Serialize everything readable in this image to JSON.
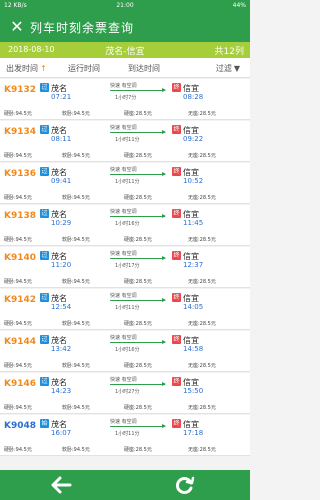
{
  "status": {
    "left": "12 KB/s",
    "center": "21:00",
    "right": "44%"
  },
  "header": {
    "title": "列车时刻余票查询"
  },
  "info": {
    "date": "2018-08-10",
    "route": "茂名-信宜",
    "count": "共12列"
  },
  "sort": {
    "depart": "出发时间",
    "depart_arrow": "↑",
    "run": "运行时间",
    "arrive": "到达时间",
    "filter": "过滤",
    "filter_icon": "▼"
  },
  "icons": {
    "close": "close-icon",
    "back": "back-arrow-icon",
    "refresh": "refresh-icon",
    "filter": "funnel-icon"
  },
  "colors": {
    "green": "#2e9d4c",
    "lime": "#a6cd3a",
    "orange": "#f08a1c",
    "blue": "#2a6fd0",
    "red": "#e8494f"
  },
  "trains": [
    {
      "code": "K9132",
      "from": "茂名",
      "dep": "07:21",
      "to": "信宜",
      "arr": "08:28",
      "start_badge": "过",
      "end_badge": "终",
      "mid": "快速 有空调",
      "dur": "1小时7分",
      "s1": "硬卧:94.5元",
      "s2": "软卧:94.5元",
      "s3": "硬座:28.5元",
      "s4": "无座:28.5元",
      "code_color": "orange"
    },
    {
      "code": "K9134",
      "from": "茂名",
      "dep": "08:11",
      "to": "信宜",
      "arr": "09:22",
      "start_badge": "过",
      "end_badge": "终",
      "mid": "快速 有空调",
      "dur": "1小时11分",
      "s1": "硬卧:94.5元",
      "s2": "软卧:94.5元",
      "s3": "硬座:28.5元",
      "s4": "无座:28.5元",
      "code_color": "orange"
    },
    {
      "code": "K9136",
      "from": "茂名",
      "dep": "09:41",
      "to": "信宜",
      "arr": "10:52",
      "start_badge": "过",
      "end_badge": "终",
      "mid": "快速 有空调",
      "dur": "1小时11分",
      "s1": "硬卧:94.5元",
      "s2": "软卧:94.5元",
      "s3": "硬座:28.5元",
      "s4": "无座:28.5元",
      "code_color": "orange"
    },
    {
      "code": "K9138",
      "from": "茂名",
      "dep": "10:29",
      "to": "信宜",
      "arr": "11:45",
      "start_badge": "过",
      "end_badge": "终",
      "mid": "快速 有空调",
      "dur": "1小时16分",
      "s1": "硬卧:94.5元",
      "s2": "软卧:94.5元",
      "s3": "硬座:28.5元",
      "s4": "无座:28.5元",
      "code_color": "orange"
    },
    {
      "code": "K9140",
      "from": "茂名",
      "dep": "11:20",
      "to": "信宜",
      "arr": "12:37",
      "start_badge": "过",
      "end_badge": "终",
      "mid": "快速 有空调",
      "dur": "1小时17分",
      "s1": "硬卧:94.5元",
      "s2": "软卧:94.5元",
      "s3": "硬座:28.5元",
      "s4": "无座:28.5元",
      "code_color": "orange"
    },
    {
      "code": "K9142",
      "from": "茂名",
      "dep": "12:54",
      "to": "信宜",
      "arr": "14:05",
      "start_badge": "过",
      "end_badge": "终",
      "mid": "快速 有空调",
      "dur": "1小时11分",
      "s1": "硬卧:94.5元",
      "s2": "软卧:94.5元",
      "s3": "硬座:28.5元",
      "s4": "无座:28.5元",
      "code_color": "orange"
    },
    {
      "code": "K9144",
      "from": "茂名",
      "dep": "13:42",
      "to": "信宜",
      "arr": "14:58",
      "start_badge": "过",
      "end_badge": "终",
      "mid": "快速 有空调",
      "dur": "1小时16分",
      "s1": "硬卧:94.5元",
      "s2": "软卧:94.5元",
      "s3": "硬座:28.5元",
      "s4": "无座:28.5元",
      "code_color": "orange"
    },
    {
      "code": "K9146",
      "from": "茂名",
      "dep": "14:23",
      "to": "信宜",
      "arr": "15:50",
      "start_badge": "过",
      "end_badge": "终",
      "mid": "快速 有空调",
      "dur": "1小时27分",
      "s1": "硬卧:94.5元",
      "s2": "软卧:94.5元",
      "s3": "硬座:28.5元",
      "s4": "无座:28.5元",
      "code_color": "orange"
    },
    {
      "code": "K9048",
      "from": "茂名",
      "dep": "16:07",
      "to": "信宜",
      "arr": "17:18",
      "start_badge": "始",
      "end_badge": "终",
      "mid": "快速 有空调",
      "dur": "1小时11分",
      "s1": "硬卧:94.5元",
      "s2": "软卧:94.5元",
      "s3": "硬座:28.5元",
      "s4": "无座:28.5元",
      "code_color": "blue"
    }
  ]
}
